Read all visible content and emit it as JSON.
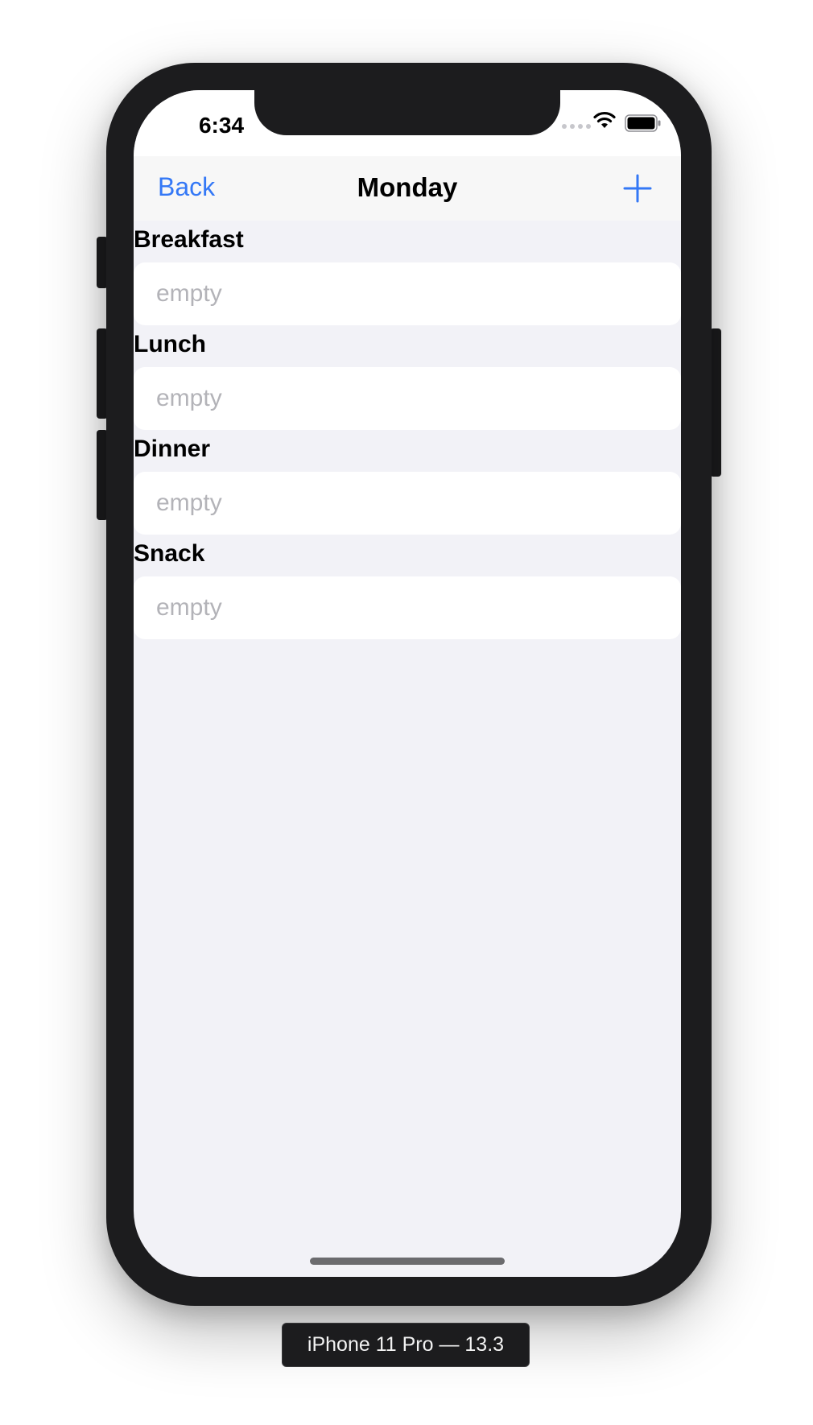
{
  "status_bar": {
    "time": "6:34"
  },
  "nav": {
    "back_label": "Back",
    "title": "Monday",
    "add_icon": "plus-icon"
  },
  "sections": [
    {
      "header": "Breakfast",
      "row_text": "empty"
    },
    {
      "header": "Lunch",
      "row_text": "empty"
    },
    {
      "header": "Dinner",
      "row_text": "empty"
    },
    {
      "header": "Snack",
      "row_text": "empty"
    }
  ],
  "device_label": "iPhone 11 Pro — 13.3",
  "colors": {
    "accent": "#3478f6",
    "background": "#f2f2f7",
    "placeholder_text": "#b3b3b8",
    "device_frame": "#1c1c1e"
  }
}
